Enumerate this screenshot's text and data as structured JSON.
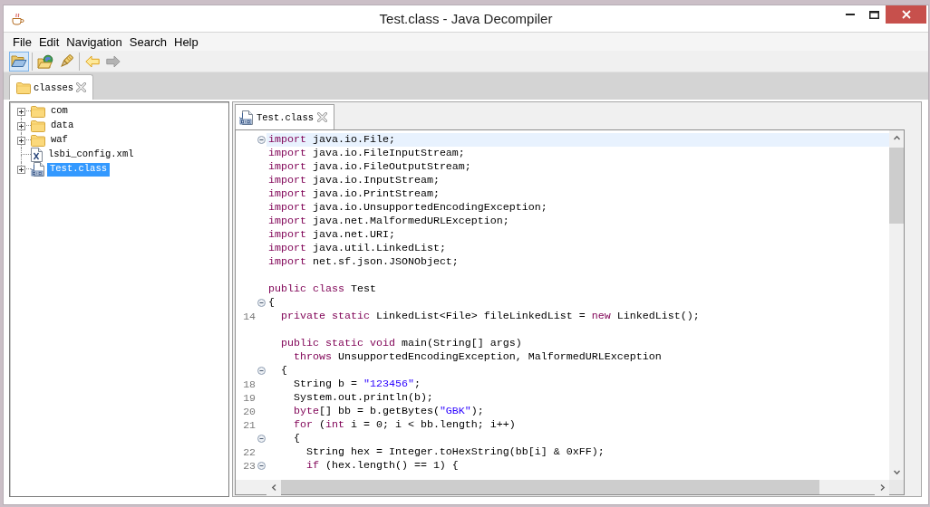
{
  "window": {
    "title": "Test.class - Java Decompiler"
  },
  "menu": [
    "File",
    "Edit",
    "Navigation",
    "Search",
    "Help"
  ],
  "toolbar": {
    "groups": [
      {
        "buttons": [
          {
            "highlighted": true,
            "disabled": false
          }
        ]
      },
      {
        "buttons": [
          {
            "highlighted": false,
            "disabled": false
          },
          {
            "highlighted": false,
            "disabled": false
          }
        ]
      },
      {
        "buttons": [
          {
            "highlighted": false,
            "disabled": false
          },
          {
            "highlighted": false,
            "disabled": true
          }
        ]
      }
    ]
  },
  "workspace_tabs": [
    {
      "label": "classes",
      "selected": true
    }
  ],
  "tree": {
    "items": [
      {
        "kind": "folder",
        "label": "com",
        "expandable": true,
        "selected": false
      },
      {
        "kind": "folder",
        "label": "data",
        "expandable": true,
        "selected": false
      },
      {
        "kind": "folder",
        "label": "waf",
        "expandable": true,
        "selected": false
      },
      {
        "kind": "xml",
        "label": "lsbi_config.xml",
        "expandable": false,
        "selected": false
      },
      {
        "kind": "class",
        "label": "Test.class",
        "expandable": true,
        "selected": true
      }
    ]
  },
  "editor": {
    "tabs": [
      {
        "label": "Test.class",
        "selected": true
      }
    ],
    "lines": [
      {
        "kind": "code",
        "collapsible": true,
        "current": true,
        "tokens": [
          {
            "kind": "keyword",
            "text": "import"
          },
          {
            "kind": "plain",
            "text": " java.io.File;"
          }
        ]
      },
      {
        "kind": "code",
        "collapsible": false,
        "current": false,
        "tokens": [
          {
            "kind": "keyword",
            "text": "import"
          },
          {
            "kind": "plain",
            "text": " java.io.FileInputStream;"
          }
        ]
      },
      {
        "kind": "code",
        "collapsible": false,
        "current": false,
        "tokens": [
          {
            "kind": "keyword",
            "text": "import"
          },
          {
            "kind": "plain",
            "text": " java.io.FileOutputStream;"
          }
        ]
      },
      {
        "kind": "code",
        "collapsible": false,
        "current": false,
        "tokens": [
          {
            "kind": "keyword",
            "text": "import"
          },
          {
            "kind": "plain",
            "text": " java.io.InputStream;"
          }
        ]
      },
      {
        "kind": "code",
        "collapsible": false,
        "current": false,
        "tokens": [
          {
            "kind": "keyword",
            "text": "import"
          },
          {
            "kind": "plain",
            "text": " java.io.PrintStream;"
          }
        ]
      },
      {
        "kind": "code",
        "collapsible": false,
        "current": false,
        "tokens": [
          {
            "kind": "keyword",
            "text": "import"
          },
          {
            "kind": "plain",
            "text": " java.io.UnsupportedEncodingException;"
          }
        ]
      },
      {
        "kind": "code",
        "collapsible": false,
        "current": false,
        "tokens": [
          {
            "kind": "keyword",
            "text": "import"
          },
          {
            "kind": "plain",
            "text": " java.net.MalformedURLException;"
          }
        ]
      },
      {
        "kind": "code",
        "collapsible": false,
        "current": false,
        "tokens": [
          {
            "kind": "keyword",
            "text": "import"
          },
          {
            "kind": "plain",
            "text": " java.net.URI;"
          }
        ]
      },
      {
        "kind": "code",
        "collapsible": false,
        "current": false,
        "tokens": [
          {
            "kind": "keyword",
            "text": "import"
          },
          {
            "kind": "plain",
            "text": " java.util.LinkedList;"
          }
        ]
      },
      {
        "kind": "code",
        "collapsible": false,
        "current": false,
        "tokens": [
          {
            "kind": "keyword",
            "text": "import"
          },
          {
            "kind": "plain",
            "text": " net.sf.json.JSONObject;"
          }
        ]
      },
      {
        "kind": "blank"
      },
      {
        "kind": "code",
        "collapsible": false,
        "current": false,
        "tokens": [
          {
            "kind": "keyword",
            "text": "public class"
          },
          {
            "kind": "plain",
            "text": " Test"
          }
        ]
      },
      {
        "kind": "code",
        "collapsible": true,
        "current": false,
        "tokens": [
          {
            "kind": "plain",
            "text": "{"
          }
        ]
      },
      {
        "kind": "code",
        "number": "14",
        "collapsible": false,
        "current": false,
        "tokens": [
          {
            "kind": "keyword",
            "text": "  private static"
          },
          {
            "kind": "plain",
            "text": " LinkedList<File> fileLinkedList = "
          },
          {
            "kind": "keyword",
            "text": "new"
          },
          {
            "kind": "plain",
            "text": " LinkedList();"
          }
        ]
      },
      {
        "kind": "blank"
      },
      {
        "kind": "code",
        "collapsible": false,
        "current": false,
        "tokens": [
          {
            "kind": "keyword",
            "text": "  public static void"
          },
          {
            "kind": "plain",
            "text": " main(String[] args)"
          }
        ]
      },
      {
        "kind": "code",
        "collapsible": false,
        "current": false,
        "tokens": [
          {
            "kind": "keyword",
            "text": "    throws"
          },
          {
            "kind": "plain",
            "text": " UnsupportedEncodingException, MalformedURLException"
          }
        ]
      },
      {
        "kind": "code",
        "collapsible": true,
        "current": false,
        "tokens": [
          {
            "kind": "plain",
            "text": "  {"
          }
        ]
      },
      {
        "kind": "code",
        "number": "18",
        "collapsible": false,
        "current": false,
        "tokens": [
          {
            "kind": "plain",
            "text": "    String b = "
          },
          {
            "kind": "string",
            "text": "\"123456\""
          },
          {
            "kind": "plain",
            "text": ";"
          }
        ]
      },
      {
        "kind": "code",
        "number": "19",
        "collapsible": false,
        "current": false,
        "tokens": [
          {
            "kind": "plain",
            "text": "    System.out.println(b);"
          }
        ]
      },
      {
        "kind": "code",
        "number": "20",
        "collapsible": false,
        "current": false,
        "tokens": [
          {
            "kind": "keyword",
            "text": "    byte"
          },
          {
            "kind": "plain",
            "text": "[] bb = b.getBytes("
          },
          {
            "kind": "string",
            "text": "\"GBK\""
          },
          {
            "kind": "plain",
            "text": ");"
          }
        ]
      },
      {
        "kind": "code",
        "number": "21",
        "collapsible": false,
        "current": false,
        "tokens": [
          {
            "kind": "keyword",
            "text": "    for"
          },
          {
            "kind": "plain",
            "text": " ("
          },
          {
            "kind": "keyword",
            "text": "int"
          },
          {
            "kind": "plain",
            "text": " i = 0; i < bb.length; i++)"
          }
        ]
      },
      {
        "kind": "code",
        "collapsible": true,
        "current": false,
        "tokens": [
          {
            "kind": "plain",
            "text": "    {"
          }
        ]
      },
      {
        "kind": "code",
        "number": "22",
        "collapsible": false,
        "current": false,
        "tokens": [
          {
            "kind": "plain",
            "text": "      String hex = Integer.toHexString(bb[i] & 0xFF);"
          }
        ]
      },
      {
        "kind": "code",
        "number": "23",
        "collapsible": true,
        "current": false,
        "tokens": [
          {
            "kind": "keyword",
            "text": "      if"
          },
          {
            "kind": "plain",
            "text": " (hex.length() == 1) {"
          }
        ]
      }
    ]
  }
}
